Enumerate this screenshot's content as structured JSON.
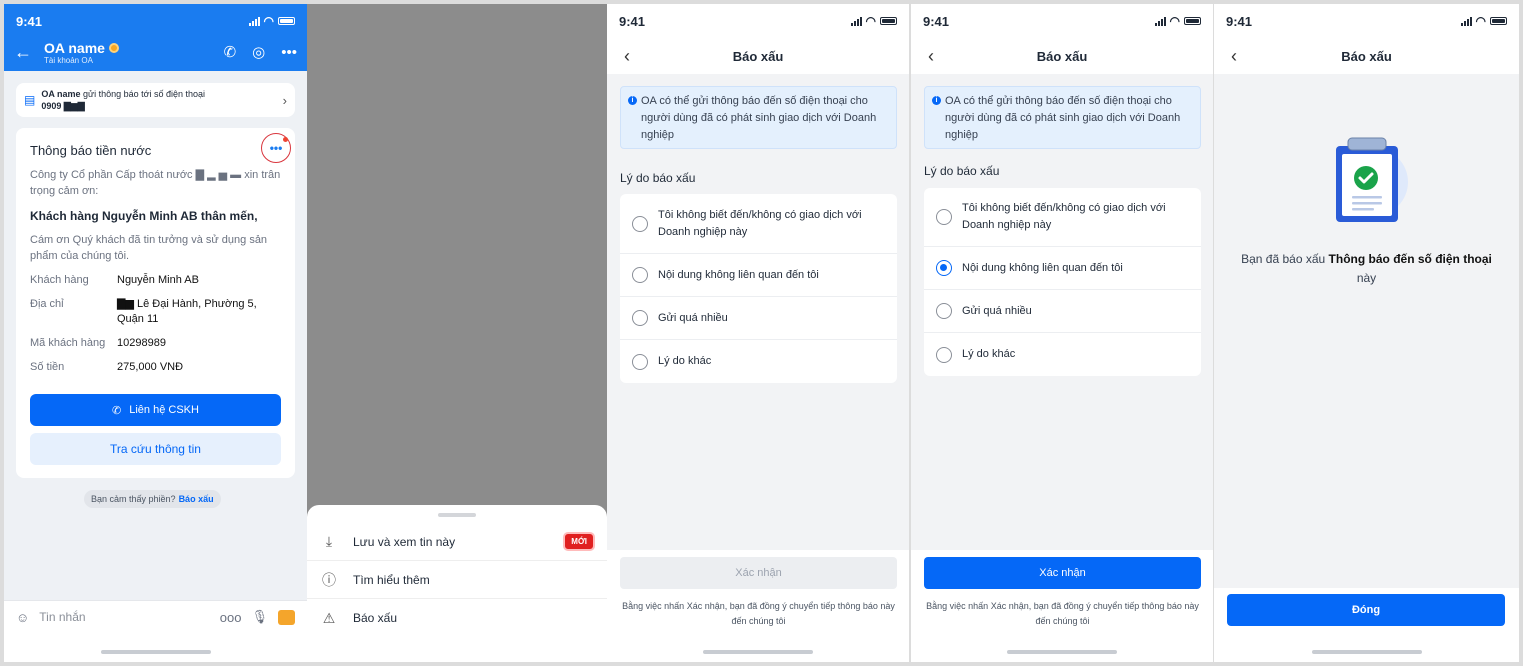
{
  "status_time": "9:41",
  "chat": {
    "oa_name": "OA name",
    "oa_sub": "Tài khoản OA",
    "notice_bold": "OA name",
    "notice_text": "gửi thông báo tới số điện thoại",
    "notice_phone": "0909 ▇▆▇",
    "msg_title": "Thông báo tiền nước",
    "more_label": "•••",
    "msg_intro": "Công ty Cổ phần Cấp thoát nước ▇ ▂ ▅ ▬ xin trân trọng cảm ơn:",
    "msg_greet": "Khách hàng Nguyễn Minh AB thân mến,",
    "msg_body": "Cám ơn Quý khách đã tin tưởng và sử dụng sản phẩm của chúng tôi.",
    "rows": [
      {
        "k": "Khách hàng",
        "v": "Nguyễn Minh AB"
      },
      {
        "k": "Địa chỉ",
        "v": "▇▆ Lê Đại Hành, Phường 5, Quận 11"
      },
      {
        "k": "Mã khách hàng",
        "v": "10298989"
      },
      {
        "k": "Số tiền",
        "v": "275,000 VNĐ"
      }
    ],
    "cskh_label": "Liên hệ CSKH",
    "lookup_label": "Tra cứu thông tin",
    "feedback_text": "Bạn cảm thấy phiền?",
    "feedback_link": "Báo xấu",
    "composer_placeholder": "Tin nhắn",
    "composer_more": "ooo"
  },
  "sheet": {
    "save_label": "Lưu và xem tin này",
    "new_badge": "MỚI",
    "learn_label": "Tìm hiểu thêm",
    "report_label": "Báo xấu"
  },
  "report": {
    "title": "Báo xấu",
    "info": "OA có thể gửi thông báo đến số điện thoại cho người dùng đã có phát sinh giao dịch với Doanh nghiệp",
    "reason_label": "Lý do báo xấu",
    "options": [
      "Tôi không biết đến/không có giao dịch với Doanh nghiệp này",
      "Nội dung không liên quan đến tôi",
      "Gửi quá nhiều",
      "Lý do khác"
    ],
    "confirm_label": "Xác nhận",
    "terms": "Bằng việc nhấn Xác nhận, bạn đã đồng ý chuyển tiếp thông báo này đến chúng tôi",
    "selected_index_screen4": 1
  },
  "success": {
    "title": "Báo xấu",
    "text_pre": "Bạn đã báo xấu",
    "text_bold": "Thông báo đến số điện thoại",
    "text_post": "này",
    "close_label": "Đóng"
  },
  "colors": {
    "primary": "#0568f7",
    "header_blue": "#1a7cf0",
    "danger": "#e02020"
  }
}
